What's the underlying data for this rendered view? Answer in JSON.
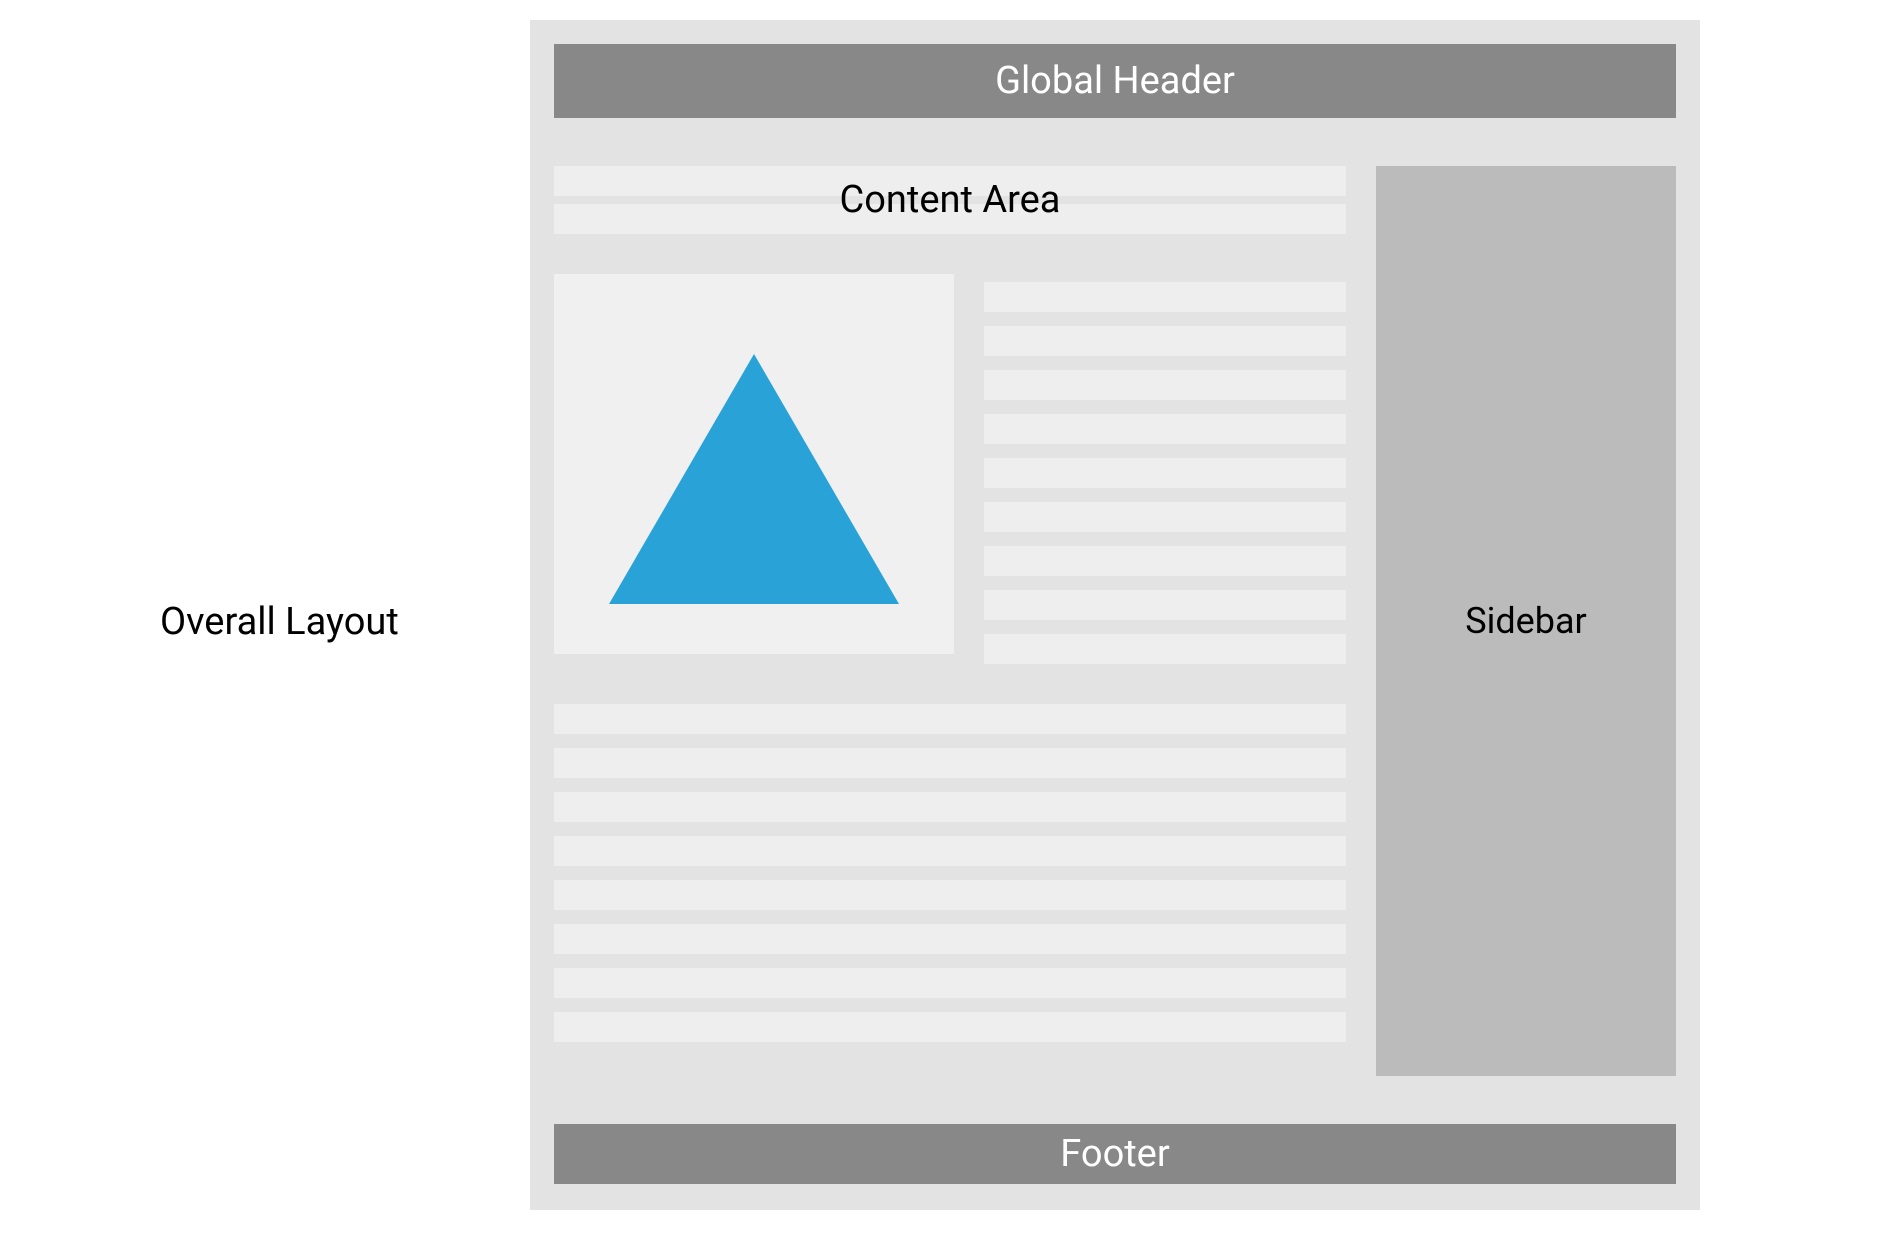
{
  "labels": {
    "overall_layout": "Overall Layout",
    "global_header": "Global Header",
    "content_area": "Content Area",
    "sidebar": "Sidebar",
    "footer": "Footer"
  },
  "colors": {
    "container_bg": "#e3e3e3",
    "header_bg": "#888888",
    "sidebar_bg": "#bbbbbb",
    "line_bg": "#eeeeee",
    "image_bg": "#f0f0f0",
    "triangle": "#29a3d7",
    "header_text": "#ffffff",
    "body_text": "#000000"
  }
}
